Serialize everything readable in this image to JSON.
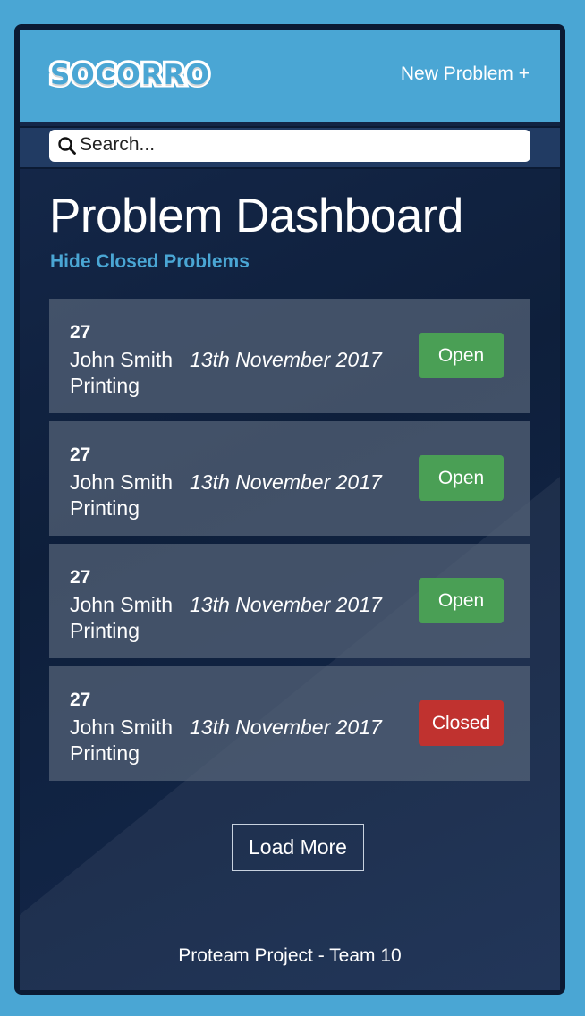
{
  "header": {
    "logo_text": "SOCORRO",
    "new_problem_label": "New Problem +"
  },
  "search": {
    "placeholder": "Search...",
    "value": ""
  },
  "main": {
    "title": "Problem Dashboard",
    "hide_closed_label": "Hide Closed Problems",
    "problems": [
      {
        "id": "27",
        "name": "John Smith",
        "date": "13th November 2017",
        "category": "Printing",
        "status": "Open"
      },
      {
        "id": "27",
        "name": "John Smith",
        "date": "13th November 2017",
        "category": "Printing",
        "status": "Open"
      },
      {
        "id": "27",
        "name": "John Smith",
        "date": "13th November 2017",
        "category": "Printing",
        "status": "Open"
      },
      {
        "id": "27",
        "name": "John Smith",
        "date": "13th November 2017",
        "category": "Printing",
        "status": "Closed"
      }
    ],
    "load_more_label": "Load More"
  },
  "footer": {
    "text": "Proteam Project - Team 10"
  },
  "colors": {
    "brand": "#4aa6d4",
    "open": "#4a9f55",
    "closed": "#c0322f"
  },
  "icons": {
    "search": "search-icon"
  }
}
